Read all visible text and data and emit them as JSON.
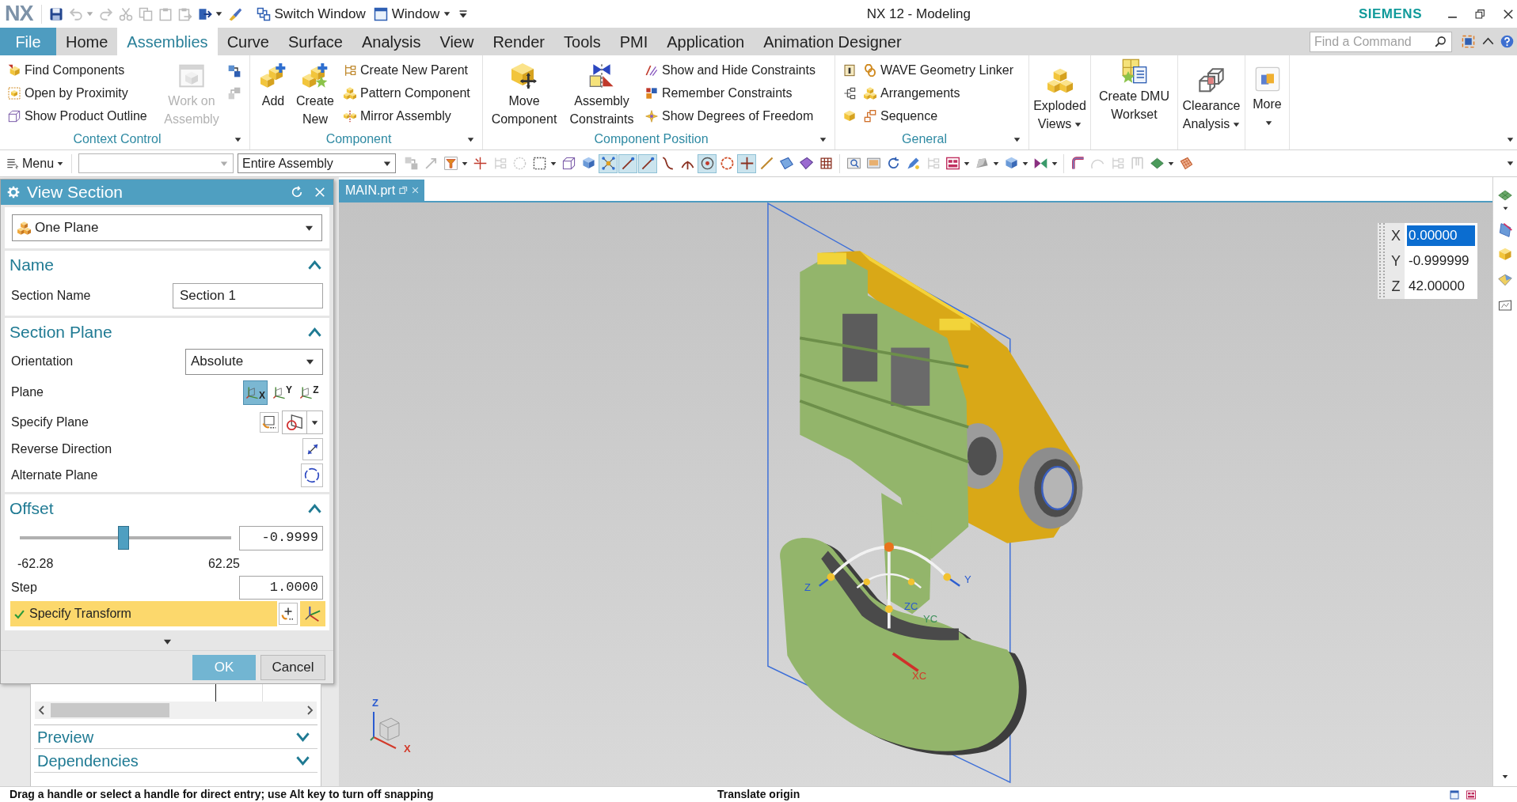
{
  "title_bar": {
    "logo": "NX",
    "quick_access": [
      {
        "kind": "save",
        "disabled": false,
        "dropdown": false
      },
      {
        "kind": "undo",
        "disabled": true,
        "dropdown": true
      },
      {
        "kind": "redo",
        "disabled": true,
        "dropdown": false
      },
      {
        "kind": "cut",
        "disabled": true,
        "dropdown": false
      },
      {
        "kind": "copy",
        "disabled": true,
        "dropdown": false
      },
      {
        "kind": "paste",
        "disabled": true,
        "dropdown": false
      },
      {
        "kind": "pastespecial",
        "disabled": true,
        "dropdown": false
      },
      {
        "kind": "pagearrow",
        "disabled": false,
        "dropdown": true
      },
      {
        "kind": "brush",
        "disabled": false,
        "dropdown": false
      }
    ],
    "switch_window": "Switch Window",
    "window_menu": "Window",
    "title": "NX 12 - Modeling",
    "brand": "SIEMENS"
  },
  "menu_tabs": [
    {
      "label": "File",
      "kind": "file",
      "selected": false
    },
    {
      "label": "Home",
      "kind": "tab",
      "selected": false
    },
    {
      "label": "Assemblies",
      "kind": "tab",
      "selected": true
    },
    {
      "label": "Curve",
      "kind": "tab",
      "selected": false
    },
    {
      "label": "Surface",
      "kind": "tab",
      "selected": false
    },
    {
      "label": "Analysis",
      "kind": "tab",
      "selected": false
    },
    {
      "label": "View",
      "kind": "tab",
      "selected": false
    },
    {
      "label": "Render",
      "kind": "tab",
      "selected": false
    },
    {
      "label": "Tools",
      "kind": "tab",
      "selected": false
    },
    {
      "label": "PMI",
      "kind": "tab",
      "selected": false
    },
    {
      "label": "Application",
      "kind": "tab",
      "selected": false
    },
    {
      "label": "Animation Designer",
      "kind": "tab",
      "selected": false
    }
  ],
  "command_search": {
    "placeholder": "Find a Command"
  },
  "ribbon": {
    "context_control": {
      "label": "Context Control",
      "items": [
        "Find Components",
        "Open by Proximity",
        "Show Product Outline"
      ],
      "work_on_assembly": {
        "label": "Work on Assembly",
        "disabled": true
      },
      "side_tools": [
        {
          "disabled": false
        },
        {
          "disabled": true
        }
      ]
    },
    "component": {
      "label": "Component",
      "buttons": [
        {
          "label": "Add",
          "disabled": false
        },
        {
          "label": "Create New",
          "disabled": false
        }
      ],
      "items": [
        "Create New Parent",
        "Pattern Component",
        "Mirror Assembly"
      ]
    },
    "component_position": {
      "label": "Component Position",
      "buttons": [
        {
          "label": "Move Component",
          "disabled": false
        },
        {
          "label": "Assembly Constraints",
          "disabled": false
        }
      ],
      "items": [
        "Show and Hide Constraints",
        "Remember Constraints",
        "Show Degrees of Freedom"
      ]
    },
    "general": {
      "label": "General",
      "items": [
        "WAVE Geometry Linker",
        "Arrangements",
        "Sequence"
      ]
    },
    "standalone": [
      {
        "label": "Exploded Views",
        "dropdown": true
      },
      {
        "label": "Create DMU Workset",
        "dropdown": false
      },
      {
        "label": "Clearance Analysis",
        "dropdown": true
      },
      {
        "label": "More",
        "dropdown": true
      }
    ]
  },
  "selection_bar": {
    "menu": "Menu",
    "scope": "Entire Assembly",
    "tool_groups": [
      {
        "tools": [
          {
            "kind": "squares",
            "on": false,
            "disabled": true,
            "dropdown": false
          },
          {
            "kind": "arrow",
            "on": false,
            "disabled": true,
            "dropdown": false
          },
          {
            "kind": "filter",
            "on": false,
            "disabled": false,
            "dropdown": true
          },
          {
            "kind": "crosshair",
            "on": false,
            "disabled": false,
            "dropdown": false
          },
          {
            "kind": "tree",
            "on": false,
            "disabled": true,
            "dropdown": false
          },
          {
            "kind": "dashcircle",
            "on": false,
            "disabled": true,
            "dropdown": false
          },
          {
            "kind": "dashsquare",
            "on": false,
            "disabled": false,
            "dropdown": true
          },
          {
            "kind": "wirecube",
            "on": false,
            "disabled": false,
            "dropdown": false
          },
          {
            "kind": "cubeb",
            "on": false,
            "disabled": false,
            "dropdown": false
          },
          {
            "kind": "points",
            "on": true,
            "disabled": false,
            "dropdown": false
          },
          {
            "kind": "line",
            "on": true,
            "disabled": false,
            "dropdown": false
          },
          {
            "kind": "line",
            "on": true,
            "disabled": false,
            "dropdown": false
          },
          {
            "kind": "curve",
            "on": false,
            "disabled": false,
            "dropdown": false
          },
          {
            "kind": "intersect",
            "on": false,
            "disabled": false,
            "dropdown": false
          },
          {
            "kind": "target",
            "on": true,
            "disabled": false,
            "dropdown": false
          },
          {
            "kind": "circle",
            "on": false,
            "disabled": false,
            "dropdown": false
          },
          {
            "kind": "plus",
            "on": true,
            "disabled": false,
            "dropdown": false
          },
          {
            "kind": "slant",
            "on": false,
            "disabled": false,
            "dropdown": false
          },
          {
            "kind": "plane",
            "on": false,
            "disabled": false,
            "dropdown": false
          },
          {
            "kind": "surface",
            "on": false,
            "disabled": false,
            "dropdown": false
          },
          {
            "kind": "grid",
            "on": false,
            "disabled": false,
            "dropdown": false
          }
        ]
      },
      {
        "tools": [
          {
            "kind": "zoom",
            "on": false,
            "disabled": false,
            "dropdown": false
          },
          {
            "kind": "screen",
            "on": false,
            "disabled": false,
            "dropdown": false
          },
          {
            "kind": "rotate",
            "on": false,
            "disabled": false,
            "dropdown": false
          },
          {
            "kind": "pencil",
            "on": false,
            "disabled": false,
            "dropdown": false
          },
          {
            "kind": "tree",
            "on": false,
            "disabled": true,
            "dropdown": false
          },
          {
            "kind": "layout",
            "on": false,
            "disabled": false,
            "dropdown": true
          },
          {
            "kind": "shade",
            "on": false,
            "disabled": false,
            "dropdown": true
          },
          {
            "kind": "cubeb",
            "on": false,
            "disabled": false,
            "dropdown": true
          },
          {
            "kind": "section",
            "on": false,
            "disabled": false,
            "dropdown": true
          }
        ]
      },
      {
        "tools": [
          {
            "kind": "pipe",
            "on": false,
            "disabled": false,
            "dropdown": false
          },
          {
            "kind": "arc",
            "on": false,
            "disabled": true,
            "dropdown": false
          },
          {
            "kind": "tree",
            "on": false,
            "disabled": true,
            "dropdown": false
          },
          {
            "kind": "frame",
            "on": false,
            "disabled": true,
            "dropdown": false
          },
          {
            "kind": "planeg",
            "on": false,
            "disabled": false,
            "dropdown": true
          },
          {
            "kind": "mesh",
            "on": false,
            "disabled": false,
            "dropdown": false
          }
        ]
      }
    ]
  },
  "view_section_dialog": {
    "title": "View Section",
    "type": "One Plane",
    "name_group": {
      "title": "Name",
      "expanded": true,
      "label": "Section Name",
      "value": "Section 1"
    },
    "section_plane": {
      "title": "Section Plane",
      "expanded": true,
      "orientation_label": "Orientation",
      "orientation": "Absolute",
      "plane_label": "Plane",
      "planes": [
        {
          "axis": "X",
          "selected": true
        },
        {
          "axis": "Y",
          "selected": false
        },
        {
          "axis": "Z",
          "selected": false
        }
      ],
      "specify_plane": "Specify Plane",
      "reverse_direction": "Reverse Direction",
      "alternate_plane": "Alternate Plane"
    },
    "offset": {
      "title": "Offset",
      "expanded": true,
      "level": 0.49,
      "value": "-0.9999",
      "min": "-62.28",
      "max": "62.25",
      "step_label": "Step",
      "step": "1.0000",
      "transform": {
        "label": "Specify Transform",
        "done": true,
        "highlighted": true
      }
    },
    "buttons": [
      {
        "label": "OK",
        "kind": "primary"
      },
      {
        "label": "Cancel",
        "kind": "secondary"
      }
    ]
  },
  "navigator_panel": {
    "sections": [
      {
        "title": "Preview",
        "expanded": false
      },
      {
        "title": "Dependencies",
        "expanded": false
      }
    ]
  },
  "document_tabs": [
    {
      "label": "MAIN.prt",
      "selected": true
    }
  ],
  "viewport": {
    "coordinates": [
      {
        "axis": "X",
        "value": "0.00000",
        "selected": true
      },
      {
        "axis": "Y",
        "value": "-0.999999",
        "selected": false
      },
      {
        "axis": "Z",
        "value": "42.00000",
        "selected": false
      }
    ],
    "handle_labels": [
      {
        "text": "Z",
        "color": "#2a5bd0"
      },
      {
        "text": "Y",
        "color": "#2a5bd0"
      },
      {
        "text": "ZC",
        "color": "#2a5bd0"
      },
      {
        "text": "YC",
        "color": "#3c8f5a"
      },
      {
        "text": "XC",
        "color": "#d23a2a"
      }
    ],
    "triad_labels": [
      {
        "text": "Z",
        "color": "#2a5bd0"
      },
      {
        "text": "X",
        "color": "#d23a2a"
      }
    ]
  },
  "status_bar": {
    "prompt": "Drag a handle or select a handle for direct entry; use Alt key to turn off snapping",
    "status": "Translate origin"
  }
}
